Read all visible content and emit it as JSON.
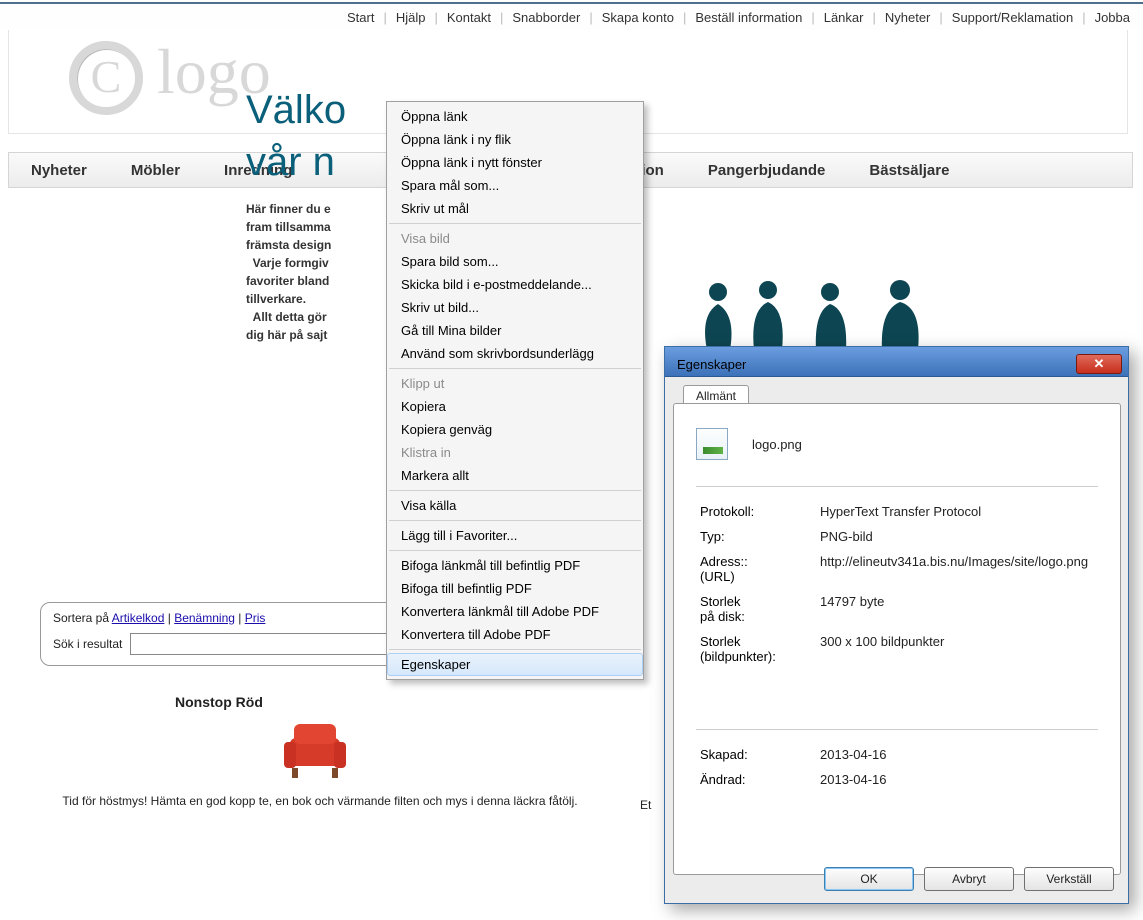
{
  "topnav": [
    "Start",
    "Hjälp",
    "Kontakt",
    "Snabborder",
    "Skapa konto",
    "Beställ information",
    "Länkar",
    "Nyheter",
    "Support/Reklamation",
    "Jobba"
  ],
  "logo_text": "logo",
  "mainnav": [
    "Nyheter",
    "Möbler",
    "Inredning",
    "tion",
    "Pangerbjudande",
    "Bästsäljare"
  ],
  "hero": {
    "line1": "Välko",
    "line2": "vår n",
    "body": "Här finner du e\nfram tillsamma\nfrämsta design\n  Varje formgiv\nfavoriter bland\ntillverkare.\n  Allt detta gör\ndig här på sajt"
  },
  "filter": {
    "sort_label": "Sortera på",
    "links": [
      "Artikelkod",
      "Benämning",
      "Pris"
    ],
    "sep": " | ",
    "search_label": "Sök i resultat"
  },
  "product": {
    "title": "Nonstop Röd",
    "desc": "Tid för höstmys! Hämta en god kopp te, en bok och värmande filten och mys i denna läckra fåtölj."
  },
  "product2_prefix": "Et",
  "context_menu": {
    "groups": [
      [
        "Öppna länk",
        "Öppna länk i ny flik",
        "Öppna länk i nytt fönster",
        "Spara mål som...",
        "Skriv ut mål"
      ],
      [
        "Visa bild",
        "Spara bild som...",
        "Skicka bild i e-postmeddelande...",
        "Skriv ut bild...",
        "Gå till Mina bilder",
        "Använd som skrivbordsunderlägg"
      ],
      [
        "Klipp ut",
        "Kopiera",
        "Kopiera genväg",
        "Klistra in",
        "Markera allt"
      ],
      [
        "Visa källa"
      ],
      [
        "Lägg till i Favoriter..."
      ],
      [
        "Bifoga länkmål till befintlig PDF",
        "Bifoga till befintlig PDF",
        "Konvertera länkmål till Adobe PDF",
        "Konvertera till Adobe PDF"
      ],
      [
        "Egenskaper"
      ]
    ],
    "disabled": [
      "Visa bild",
      "Klipp ut",
      "Klistra in"
    ],
    "hover": "Egenskaper"
  },
  "dialog": {
    "title": "Egenskaper",
    "tab": "Allmänt",
    "filename": "logo.png",
    "rows": [
      {
        "k": "Protokoll:",
        "v": "HyperText Transfer Protocol"
      },
      {
        "k": "Typ:",
        "v": "PNG-bild"
      },
      {
        "k": "Adress: (URL)",
        "v": "http://elineutv341a.bis.nu/Images/site/logo.png"
      },
      {
        "k": "Storlek på disk:",
        "v": "14797 byte"
      },
      {
        "k": "Storlek (bildpunkter):",
        "v": "300  x  100  bildpunkter"
      }
    ],
    "rows2": [
      {
        "k": "Skapad:",
        "v": "2013-04-16"
      },
      {
        "k": "Ändrad:",
        "v": "2013-04-16"
      }
    ],
    "buttons": {
      "ok": "OK",
      "cancel": "Avbryt",
      "apply": "Verkställ"
    }
  }
}
